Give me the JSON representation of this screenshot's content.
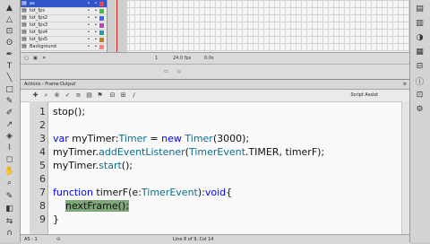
{
  "timeline": {
    "layers": [
      {
        "name": "as",
        "selected": true
      },
      {
        "name": "txt_fps"
      },
      {
        "name": "txt_fps2"
      },
      {
        "name": "txt_fps3"
      },
      {
        "name": "txt_fps4"
      },
      {
        "name": "txt_fps5"
      },
      {
        "name": "Background"
      }
    ],
    "status": {
      "frame": "1",
      "fps": "24.0 fps",
      "time": "0.0s"
    }
  },
  "actions_panel": {
    "tabs": [
      "Actions - Frame",
      "Output"
    ],
    "script_assist_label": "Script Assist",
    "line_numbers": [
      "1",
      "2",
      "3",
      "4",
      "5",
      "6",
      "7",
      "8",
      "9"
    ],
    "status_label": "AS : 1",
    "status_line": "Line 8 of 9, Col 14"
  },
  "code": {
    "line1": "stop();",
    "line3_var": "var",
    "line3_a": " myTimer:",
    "line3_type": "Timer",
    "line3_b": " = ",
    "line3_new": "new",
    "line3_c": " ",
    "line3_type2": "Timer",
    "line3_d": "(3000);",
    "line4_a": "myTimer.",
    "line4_method": "addEventListener",
    "line4_b": "(",
    "line4_cls": "TimerEvent",
    "line4_c": ".TIMER, timerF);",
    "line5_a": "myTimer.",
    "line5_method": "start",
    "line5_b": "();",
    "line7_fn": "function",
    "line7_a": " timerF(e:",
    "line7_cls": "TimerEvent",
    "line7_b": "):",
    "line7_void": "void",
    "line7_c": "{",
    "line8_a": "    ",
    "line8_highlight": "nextFrame();",
    "line9": "}"
  },
  "colors": {
    "keyword": "#0000ff",
    "class": "#0a6e8c",
    "highlight": "#7fa87a",
    "selected_layer": "#2f55c9"
  }
}
